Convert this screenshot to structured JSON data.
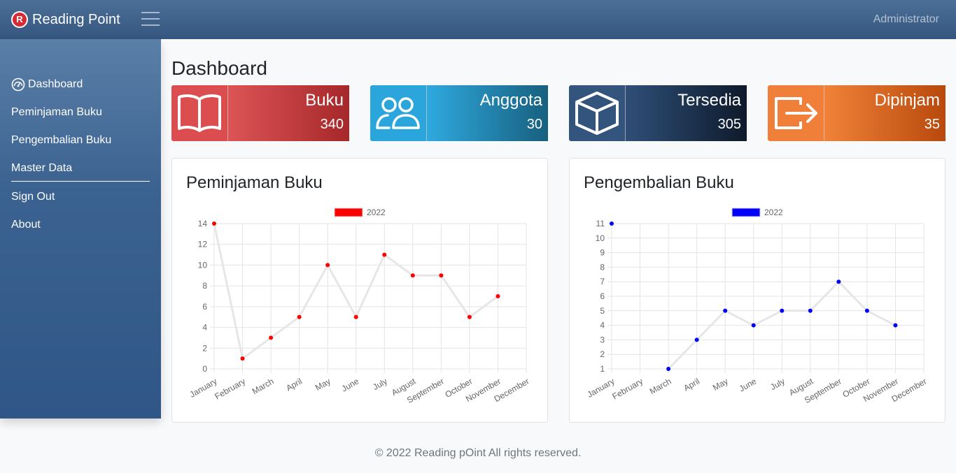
{
  "navbar": {
    "brand": "Reading Point",
    "logo_letter": "R",
    "user": "Administrator"
  },
  "sidebar": {
    "items": [
      {
        "label": "Dashboard",
        "icon": "speedometer-icon"
      },
      {
        "label": "Peminjaman Buku"
      },
      {
        "label": "Pengembalian Buku"
      },
      {
        "label": "Master Data"
      },
      {
        "label": "Sign Out"
      },
      {
        "label": "About"
      }
    ]
  },
  "page": {
    "title": "Dashboard"
  },
  "cards": [
    {
      "label": "Buku",
      "value": "340",
      "icon": "book-icon",
      "color": "#dc4d4f"
    },
    {
      "label": "Anggota",
      "value": "30",
      "icon": "users-icon",
      "color": "#2aa6dc"
    },
    {
      "label": "Tersedia",
      "value": "305",
      "icon": "box-icon",
      "color": "#33547d"
    },
    {
      "label": "Dipinjam",
      "value": "35",
      "icon": "exit-icon",
      "color": "#f07f3a"
    }
  ],
  "panels": {
    "peminjaman_title": "Peminjaman Buku",
    "pengembalian_title": "Pengembalian Buku"
  },
  "chart_data": [
    {
      "type": "line",
      "title": "Peminjaman Buku",
      "categories": [
        "January",
        "February",
        "March",
        "April",
        "May",
        "June",
        "July",
        "August",
        "September",
        "October",
        "November",
        "December"
      ],
      "series": [
        {
          "name": "2022",
          "color": "#ff0000",
          "values": [
            14,
            1,
            3,
            5,
            10,
            5,
            11,
            9,
            9,
            5,
            7,
            null
          ]
        }
      ],
      "yticks": [
        0,
        2,
        4,
        6,
        8,
        10,
        12,
        14
      ],
      "ylim": [
        0,
        14
      ],
      "grid": true,
      "legend": "top"
    },
    {
      "type": "line",
      "title": "Pengembalian Buku",
      "categories": [
        "January",
        "February",
        "March",
        "April",
        "May",
        "June",
        "July",
        "August",
        "September",
        "October",
        "November",
        "December"
      ],
      "series": [
        {
          "name": "2022",
          "color": "#0000ff",
          "values": [
            11,
            null,
            1,
            3,
            5,
            4,
            5,
            5,
            7,
            5,
            4,
            null
          ]
        }
      ],
      "yticks": [
        1,
        2,
        3,
        4,
        5,
        6,
        7,
        8,
        9,
        10,
        11
      ],
      "ylim": [
        1,
        11
      ],
      "grid": true,
      "legend": "top"
    }
  ],
  "footer": "© 2022 Reading pOint All rights reserved."
}
